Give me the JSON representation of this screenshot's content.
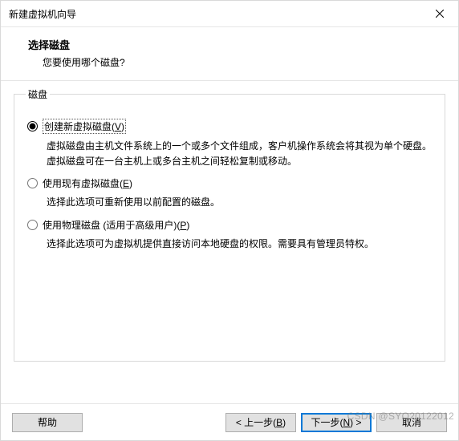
{
  "titlebar": {
    "title": "新建虚拟机向导"
  },
  "header": {
    "headline": "选择磁盘",
    "subline": "您要使用哪个磁盘?"
  },
  "group": {
    "legend": "磁盘",
    "options": [
      {
        "selected": true,
        "label_pre": "创建新虚拟磁盘(",
        "accel": "V",
        "label_post": ")",
        "desc": "虚拟磁盘由主机文件系统上的一个或多个文件组成，客户机操作系统会将其视为单个硬盘。虚拟磁盘可在一台主机上或多台主机之间轻松复制或移动。"
      },
      {
        "selected": false,
        "label_pre": "使用现有虚拟磁盘(",
        "accel": "E",
        "label_post": ")",
        "desc": "选择此选项可重新使用以前配置的磁盘。"
      },
      {
        "selected": false,
        "label_pre": "使用物理磁盘 (适用于高级用户)(",
        "accel": "P",
        "label_post": ")",
        "desc": "选择此选项可为虚拟机提供直接访问本地硬盘的权限。需要具有管理员特权。"
      }
    ]
  },
  "footer": {
    "help": "帮助",
    "back_pre": "< 上一步(",
    "back_accel": "B",
    "back_post": ")",
    "next_pre": "下一步(",
    "next_accel": "N",
    "next_post": ") >",
    "cancel": "取消"
  },
  "watermark": "CSDN @SYQ20122012"
}
